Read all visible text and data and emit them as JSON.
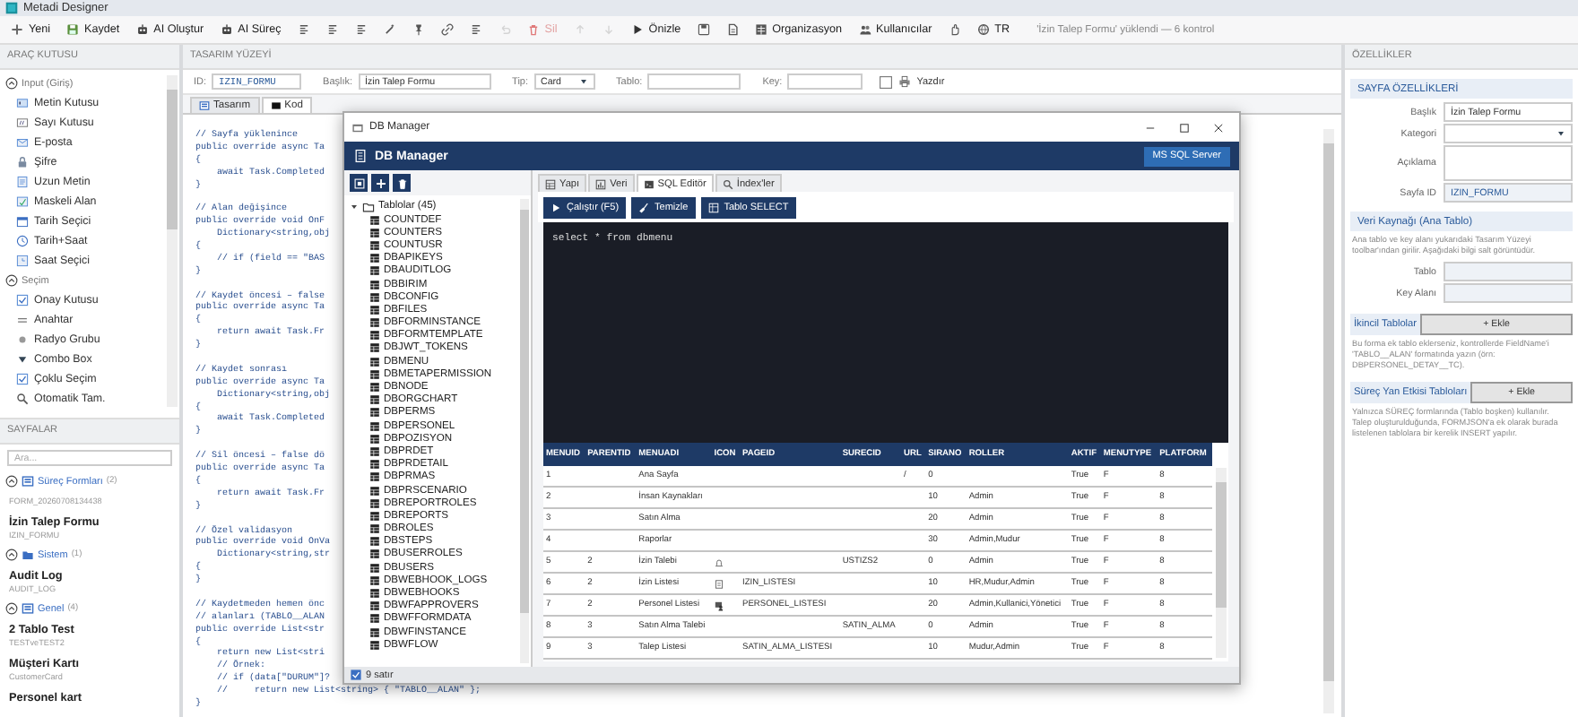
{
  "window": {
    "title": "Metadi Designer"
  },
  "toolbar": [
    {
      "kind": "button",
      "label": "Yeni",
      "disabled": false
    },
    {
      "kind": "button",
      "label": "Kaydet",
      "disabled": false
    },
    {
      "kind": "button",
      "label": "AI Oluştur",
      "disabled": false
    },
    {
      "kind": "button",
      "label": "AI Süreç",
      "disabled": false
    },
    {
      "kind": "icon",
      "disabled": false
    },
    {
      "kind": "icon",
      "disabled": false
    },
    {
      "kind": "icon",
      "disabled": false
    },
    {
      "kind": "icon",
      "disabled": false
    },
    {
      "kind": "icon",
      "disabled": false
    },
    {
      "kind": "icon",
      "disabled": false
    },
    {
      "kind": "icon",
      "disabled": false
    },
    {
      "kind": "icon",
      "disabled": true
    },
    {
      "kind": "button",
      "label": "Sil",
      "disabled": true
    },
    {
      "kind": "icon",
      "disabled": true
    },
    {
      "kind": "icon",
      "disabled": true
    },
    {
      "kind": "button",
      "label": "Önizle",
      "disabled": false
    },
    {
      "kind": "icon",
      "disabled": false
    },
    {
      "kind": "icon",
      "disabled": false
    },
    {
      "kind": "button",
      "label": "Organizasyon",
      "disabled": false
    },
    {
      "kind": "button",
      "label": "Kullanıcılar",
      "disabled": false
    },
    {
      "kind": "icon",
      "disabled": false
    },
    {
      "kind": "button",
      "label": "TR",
      "disabled": false
    }
  ],
  "status": "'İzin Talep Formu' yüklendi — 6 kontrol",
  "toolbox": {
    "title": "ARAÇ KUTUSU",
    "groups": [
      {
        "label": "Input (Giriş)",
        "expanded": true,
        "items": [
          {
            "label": "Metin Kutusu"
          },
          {
            "label": "Sayı Kutusu"
          },
          {
            "label": "E-posta"
          },
          {
            "label": "Şifre"
          },
          {
            "label": "Uzun Metin"
          },
          {
            "label": "Maskeli Alan"
          },
          {
            "label": "Tarih Seçici"
          },
          {
            "label": "Tarih+Saat"
          },
          {
            "label": "Saat Seçici"
          }
        ]
      },
      {
        "label": "Seçim",
        "expanded": true,
        "items": [
          {
            "label": "Onay Kutusu"
          },
          {
            "label": "Anahtar"
          },
          {
            "label": "Radyo Grubu"
          },
          {
            "label": "Combo Box"
          },
          {
            "label": "Çoklu Seçim"
          },
          {
            "label": "Otomatik Tam."
          }
        ]
      }
    ]
  },
  "pages": {
    "title": "SAYFALAR",
    "search": {
      "placeholder": "Ara..."
    },
    "groups": [
      {
        "label": "Süreç Formları",
        "count": "(2)",
        "expanded": true,
        "items": [
          {
            "code": "FORM_20260708134438"
          },
          {
            "title": "İzin Talep Formu",
            "code": "IZIN_FORMU"
          }
        ]
      },
      {
        "label": "Sistem",
        "count": "(1)",
        "expanded": true,
        "items": [
          {
            "title": "Audit Log",
            "code": "AUDIT_LOG"
          }
        ]
      },
      {
        "label": "Genel",
        "count": "(4)",
        "expanded": true,
        "items": [
          {
            "title": "2 Tablo Test",
            "code": "TESTveTEST2"
          },
          {
            "title": "Müşteri Kartı",
            "code": "CustomerCard"
          },
          {
            "title": "Personel kart"
          }
        ]
      }
    ]
  },
  "design": {
    "title": "TASARIM YÜZEYİ",
    "fields": [
      {
        "label": "ID:",
        "kind": "text",
        "value": "IZIN_FORMU"
      },
      {
        "label": "Başlık:",
        "kind": "text",
        "value": "İzin Talep Formu"
      },
      {
        "label": "Tip:",
        "kind": "select",
        "value": "Card"
      },
      {
        "label": "Tablo:",
        "kind": "text"
      },
      {
        "label": "Key:",
        "kind": "text"
      }
    ],
    "print": {
      "label": "Yazdır",
      "checked": false
    },
    "tabs": [
      {
        "label": "Tasarım",
        "selected": false
      },
      {
        "label": "Kod",
        "selected": true
      }
    ],
    "code": [
      [
        "// Sayfa yüklenince",
        "public override async Ta",
        "{",
        "    await Task.Completed",
        "}"
      ],
      [
        "// Alan değişince",
        "public override void OnF",
        "    Dictionary<string,obj",
        "{",
        "    // if (field == \"BAS",
        "}"
      ],
      [
        "// Kaydet öncesi – false",
        "public override async Ta",
        "{",
        "    return await Task.Fr",
        "}"
      ],
      [
        "// Kaydet sonrası",
        "public override async Ta",
        "    Dictionary<string,obj",
        "{",
        "    await Task.Completed",
        "}"
      ],
      [
        "// Sil öncesi – false dö",
        "public override async Ta",
        "{",
        "    return await Task.Fr",
        "}"
      ],
      [
        "// Özel validasyon",
        "public override void OnVa",
        "    Dictionary<string,str",
        "{",
        "}"
      ],
      [
        "// Kaydetmeden hemen önc",
        "// alanları (TABLO__ALAN",
        "public override List<str",
        "{",
        "    return new List<stri",
        "    // Örnek:",
        "    // if (data[\"DURUM\"]?",
        "    //     return new List<string> { \"TABLO__ALAN\" };",
        "}"
      ]
    ]
  },
  "properties": {
    "title": "ÖZELLİKLER",
    "sections": [
      {
        "kind": "fields",
        "title": "SAYFA ÖZELLİKLERİ",
        "fields": [
          {
            "label": "Başlık",
            "kind": "text",
            "value": "İzin Talep Formu"
          },
          {
            "label": "Kategori",
            "kind": "select"
          },
          {
            "label": "Açıklama",
            "kind": "textarea"
          },
          {
            "label": "Sayfa ID",
            "kind": "readonly",
            "value": "IZIN_FORMU"
          }
        ]
      },
      {
        "kind": "fields",
        "title": "Veri Kaynağı (Ana Tablo)",
        "note": "Ana tablo ve key alanı yukarıdaki Tasarım Yüzeyi toolbar'ından girilir. Aşağıdaki bilgi salt görüntüdür.",
        "fields": [
          {
            "label": "Tablo",
            "kind": "readonly"
          },
          {
            "label": "Key Alanı",
            "kind": "readonly"
          }
        ]
      },
      {
        "kind": "list",
        "title": "İkincil Tablolar",
        "button": "+ Ekle",
        "note": "Bu forma ek tablo eklerseniz, kontrollerde FieldName'i 'TABLO__ALAN' formatında yazın (örn: DBPERSONEL_DETAY__TC)."
      },
      {
        "kind": "list",
        "title": "Süreç Yan Etkisi Tabloları",
        "button": "+ Ekle",
        "note": "Yalnızca SÜREÇ formlarında (Tablo boşken) kullanılır. Talep oluşturulduğunda, FORMJSON'a ek olarak burada listelenen tablolara bir kerelik INSERT yapılır."
      }
    ]
  },
  "db_manager": {
    "window_title": "DB Manager",
    "title": "DB Manager",
    "server": "MS SQL Server",
    "tree": {
      "label": "Tablolar (45)",
      "expanded": true,
      "children": [
        {
          "label": "COUNTDEF"
        },
        {
          "label": "COUNTERS"
        },
        {
          "label": "COUNTUSR"
        },
        {
          "label": "DBAPIKEYS"
        },
        {
          "label": "DBAUDITLOG"
        },
        {
          "label": "DBBIRIM"
        },
        {
          "label": "DBCONFIG"
        },
        {
          "label": "DBFILES"
        },
        {
          "label": "DBFORMINSTANCE"
        },
        {
          "label": "DBFORMTEMPLATE"
        },
        {
          "label": "DBJWT_TOKENS"
        },
        {
          "label": "DBMENU"
        },
        {
          "label": "DBMETAPERMISSION"
        },
        {
          "label": "DBNODE"
        },
        {
          "label": "DBORGCHART"
        },
        {
          "label": "DBPERMS"
        },
        {
          "label": "DBPERSONEL"
        },
        {
          "label": "DBPOZISYON"
        },
        {
          "label": "DBPRDET"
        },
        {
          "label": "DBPRDETAIL"
        },
        {
          "label": "DBPRMAS"
        },
        {
          "label": "DBPRSCENARIO"
        },
        {
          "label": "DBREPORTROLES"
        },
        {
          "label": "DBREPORTS"
        },
        {
          "label": "DBROLES"
        },
        {
          "label": "DBSTEPS"
        },
        {
          "label": "DBUSERROLES"
        },
        {
          "label": "DBUSERS"
        },
        {
          "label": "DBWEBHOOK_LOGS"
        },
        {
          "label": "DBWEBHOOKS"
        },
        {
          "label": "DBWFAPPROVERS"
        },
        {
          "label": "DBWFFORMDATA"
        },
        {
          "label": "DBWFINSTANCE"
        },
        {
          "label": "DBWFLOW"
        }
      ]
    },
    "tabs": [
      {
        "label": "Yapı",
        "selected": false
      },
      {
        "label": "Veri",
        "selected": false
      },
      {
        "label": "SQL Editör",
        "selected": true
      },
      {
        "label": "İndex'ler",
        "selected": false
      }
    ],
    "actions": [
      {
        "label": "Çalıştır (F5)"
      },
      {
        "label": "Temizle"
      },
      {
        "label": "Tablo SELECT"
      }
    ],
    "query": "select * from dbmenu",
    "columns": [
      "MENUID",
      "PARENTID",
      "MENUADI",
      "ICON",
      "PAGEID",
      "SURECID",
      "URL",
      "SIRANO",
      "ROLLER",
      "AKTIF",
      "MENUTYPE",
      "PLATFORM"
    ],
    "rows": [
      {
        "has_icon": false,
        "cells": [
          "1",
          null,
          "Ana Sayfa",
          null,
          null,
          null,
          "/",
          "0",
          null,
          "True",
          "F",
          "8"
        ]
      },
      {
        "has_icon": false,
        "cells": [
          "2",
          null,
          "İnsan Kaynakları",
          null,
          null,
          null,
          null,
          "10",
          "Admin",
          "True",
          "F",
          "8"
        ]
      },
      {
        "has_icon": false,
        "cells": [
          "3",
          null,
          "Satın Alma",
          null,
          null,
          null,
          null,
          "20",
          "Admin",
          "True",
          "F",
          "8"
        ]
      },
      {
        "has_icon": false,
        "cells": [
          "4",
          null,
          "Raporlar",
          null,
          null,
          null,
          null,
          "30",
          "Admin,Mudur",
          "True",
          "F",
          "8"
        ]
      },
      {
        "has_icon": true,
        "cells": [
          "5",
          "2",
          "İzin Talebi",
          null,
          null,
          "USTIZS2",
          null,
          "0",
          "Admin",
          "True",
          "F",
          "8"
        ]
      },
      {
        "has_icon": true,
        "cells": [
          "6",
          "2",
          "İzin Listesi",
          null,
          "IZIN_LISTESI",
          null,
          null,
          "10",
          "HR,Mudur,Admin",
          "True",
          "F",
          "8"
        ]
      },
      {
        "has_icon": true,
        "cells": [
          "7",
          "2",
          "Personel Listesi",
          null,
          "PERSONEL_LISTESI",
          null,
          null,
          "20",
          "Admin,Kullanici,Yönetici",
          "True",
          "F",
          "8"
        ]
      },
      {
        "has_icon": false,
        "cells": [
          "8",
          "3",
          "Satın Alma Talebi",
          null,
          null,
          "SATIN_ALMA",
          null,
          "0",
          "Admin",
          "True",
          "F",
          "8"
        ]
      },
      {
        "has_icon": false,
        "cells": [
          "9",
          "3",
          "Talep Listesi",
          null,
          "SATIN_ALMA_LISTESI",
          null,
          null,
          "10",
          "Mudur,Admin",
          "True",
          "F",
          "8"
        ]
      }
    ],
    "status": {
      "label": "9 satır",
      "checked": true
    }
  }
}
